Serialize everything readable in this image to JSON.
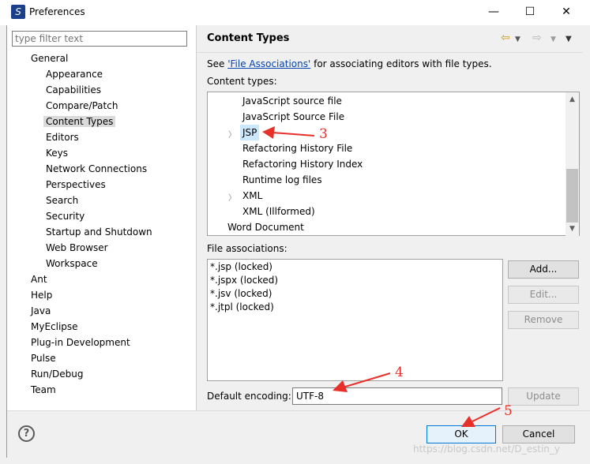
{
  "window": {
    "title": "Preferences",
    "minimize": "—",
    "maximize": "☐",
    "close": "✕"
  },
  "filter": {
    "placeholder": "type filter text"
  },
  "tree": {
    "general": "General",
    "general_children": [
      "Appearance",
      "Capabilities",
      "Compare/Patch",
      "Content Types",
      "Editors",
      "Keys",
      "Network Connections",
      "Perspectives",
      "Search",
      "Security",
      "Startup and Shutdown",
      "Web Browser",
      "Workspace"
    ],
    "top_items": [
      "Ant",
      "Help",
      "Java",
      "MyEclipse",
      "Plug-in Development",
      "Pulse",
      "Run/Debug",
      "Team"
    ],
    "selected": "Content Types"
  },
  "page": {
    "title": "Content Types",
    "see_prefix": "See ",
    "see_link": "'File Associations'",
    "see_suffix": " for associating editors with file types.",
    "content_types_label": "Content types:",
    "content_types": [
      {
        "label": "JavaScript source file",
        "twisty": false
      },
      {
        "label": "JavaScript Source File",
        "twisty": false
      },
      {
        "label": "JSP",
        "twisty": true,
        "selected": true
      },
      {
        "label": "Refactoring History File",
        "twisty": false
      },
      {
        "label": "Refactoring History Index",
        "twisty": false
      },
      {
        "label": "Runtime log files",
        "twisty": false
      },
      {
        "label": "XML",
        "twisty": true
      },
      {
        "label": "XML (Illformed)",
        "twisty": false
      },
      {
        "label": "Word Document",
        "twisty": false
      }
    ],
    "file_assoc_label": "File associations:",
    "file_associations": [
      "*.jsp (locked)",
      "*.jspx (locked)",
      "*.jsv (locked)",
      "*.jtpl (locked)"
    ],
    "buttons": {
      "add": "Add...",
      "edit": "Edit...",
      "remove": "Remove",
      "update": "Update"
    },
    "encoding_label": "Default encoding:",
    "encoding_value": "UTF-8"
  },
  "footer": {
    "help": "?",
    "ok": "OK",
    "cancel": "Cancel"
  },
  "annotations": {
    "a3": "3",
    "a4": "4",
    "a5": "5"
  },
  "watermark": "https://blog.csdn.net/D_estin_y",
  "colors": {
    "link": "#0645ad",
    "annotation": "#e8302a",
    "selection": "#dadada",
    "ok_border": "#0078d7"
  }
}
